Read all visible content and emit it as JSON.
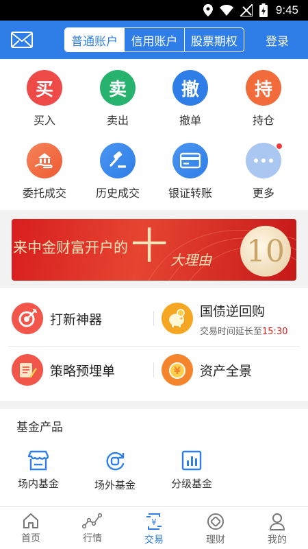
{
  "status_bar": {
    "time": "9:45"
  },
  "header": {
    "segments": [
      {
        "label": "普通账户",
        "active": true
      },
      {
        "label": "信用账户",
        "active": false
      },
      {
        "label": "股票期权",
        "active": false
      }
    ],
    "login_label": "登录"
  },
  "actions": [
    {
      "glyph": "买",
      "label": "买入",
      "color": "#ee4a48"
    },
    {
      "glyph": "卖",
      "label": "卖出",
      "color": "#27b36e"
    },
    {
      "glyph": "撤",
      "label": "撤单",
      "color": "#2f7ee8"
    },
    {
      "glyph": "持",
      "label": "持仓",
      "color": "#f26b3a"
    },
    {
      "glyph": "",
      "label": "委托成交",
      "color": "#f26b3a"
    },
    {
      "glyph": "",
      "label": "历史成交",
      "color": "#2f7ee8"
    },
    {
      "glyph": "",
      "label": "银证转账",
      "color": "#2f7ee8"
    },
    {
      "glyph": "",
      "label": "更多",
      "color": "#a9c7f0"
    }
  ],
  "banner": {
    "text": "来中金财富开户的",
    "big": "十",
    "sub": "大理由",
    "num": "10"
  },
  "features": {
    "ipo": {
      "title": "打新神器"
    },
    "repo": {
      "title": "国债逆回购",
      "sub_prefix": "交易时间延长至",
      "sub_time": "15:30"
    },
    "strategy": {
      "title": "策略预埋单"
    },
    "assets": {
      "title": "资产全景"
    }
  },
  "fund": {
    "title": "基金产品",
    "items": [
      {
        "label": "场内基金"
      },
      {
        "label": "场外基金"
      },
      {
        "label": "分级基金"
      }
    ]
  },
  "tabs": [
    {
      "label": "首页",
      "active": false
    },
    {
      "label": "行情",
      "active": false
    },
    {
      "label": "交易",
      "active": true
    },
    {
      "label": "理财",
      "active": false
    },
    {
      "label": "我的",
      "active": false
    }
  ],
  "colors": {
    "brand": "#2f7ee8",
    "highlight": "#e02020"
  }
}
